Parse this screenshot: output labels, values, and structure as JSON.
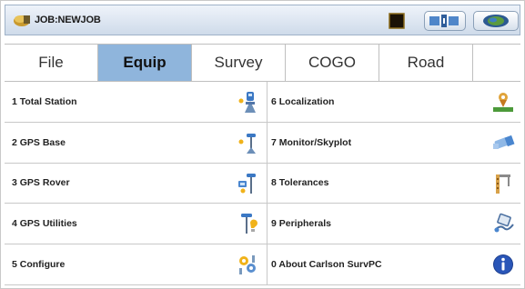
{
  "titlebar": {
    "job_title": "JOB:NEWJOB"
  },
  "tabs": [
    {
      "label": "File",
      "active": false
    },
    {
      "label": "Equip",
      "active": true
    },
    {
      "label": "Survey",
      "active": false
    },
    {
      "label": "COGO",
      "active": false
    },
    {
      "label": "Road",
      "active": false
    }
  ],
  "menu": {
    "left": [
      {
        "label": "1 Total Station",
        "icon": "total-station-icon"
      },
      {
        "label": "2 GPS Base",
        "icon": "gps-base-icon"
      },
      {
        "label": "3 GPS Rover",
        "icon": "gps-rover-icon"
      },
      {
        "label": "4 GPS Utilities",
        "icon": "gps-utilities-icon"
      },
      {
        "label": "5 Configure",
        "icon": "configure-icon"
      }
    ],
    "right": [
      {
        "label": "6 Localization",
        "icon": "localization-icon"
      },
      {
        "label": "7 Monitor/Skyplot",
        "icon": "monitor-skyplot-icon"
      },
      {
        "label": "8 Tolerances",
        "icon": "tolerances-icon"
      },
      {
        "label": "9 Peripherals",
        "icon": "peripherals-icon"
      },
      {
        "label": "0 About Carlson SurvPC",
        "icon": "info-icon"
      }
    ]
  },
  "colors": {
    "active_tab": "#8fb5dc",
    "title_bar": "#cfdbea"
  }
}
